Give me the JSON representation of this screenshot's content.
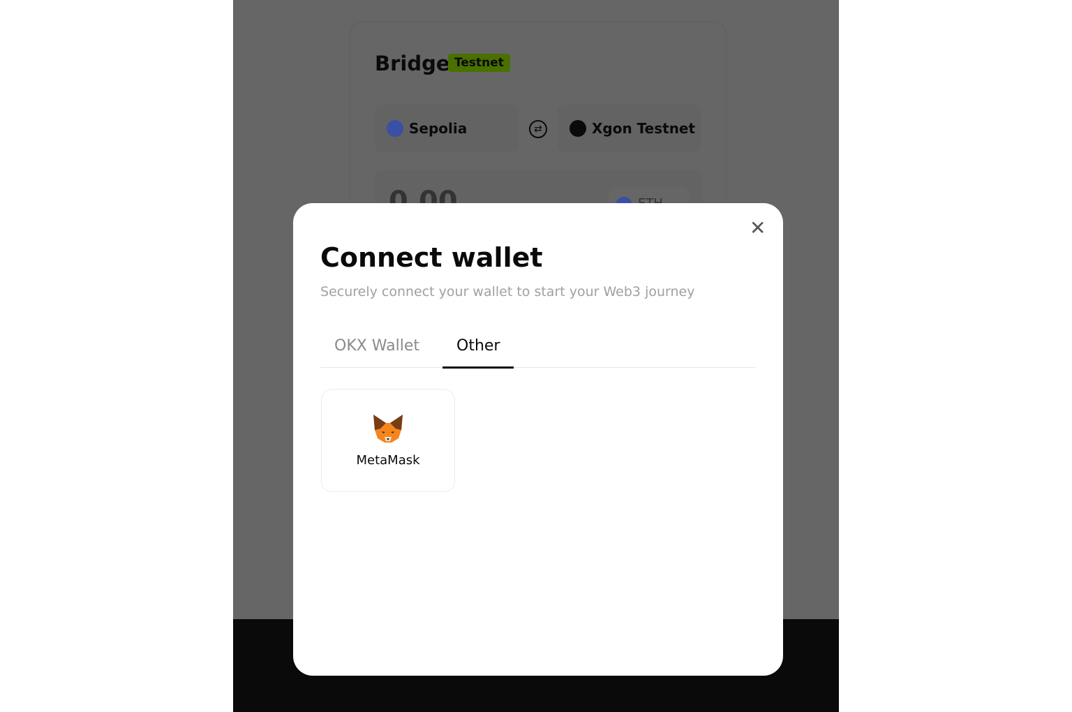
{
  "bridge": {
    "title": "Bridge",
    "badge": "Testnet",
    "from_network": "Sepolia",
    "to_network": "Xgon Testnet",
    "amount": "0.00",
    "token": "ETH"
  },
  "modal": {
    "title": "Connect wallet",
    "subtitle": "Securely connect your wallet to start your Web3 journey",
    "tabs": [
      {
        "label": "OKX Wallet",
        "active": false
      },
      {
        "label": "Other",
        "active": true
      }
    ],
    "wallets": [
      {
        "name": "MetaMask",
        "icon": "metamask-fox-icon"
      }
    ],
    "close_icon": "close-icon"
  },
  "colors": {
    "badge": "#4a7000",
    "overlay": "#666666",
    "sepolia": "#3a4fa6"
  }
}
